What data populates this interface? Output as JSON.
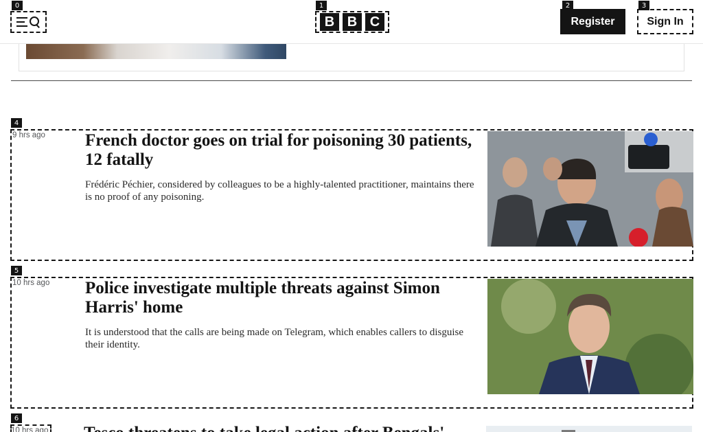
{
  "header": {
    "menu_label": "Menu and search",
    "logo_letters": [
      "B",
      "B",
      "C"
    ],
    "register_label": "Register",
    "signin_label": "Sign In",
    "badges": [
      "0",
      "1",
      "2",
      "3"
    ]
  },
  "articles": [
    {
      "badge": "4",
      "timestamp": "9 hrs ago",
      "title": "French doctor goes on trial for poisoning 30 patients, 12 fatally",
      "summary": "Frédéric Péchier, considered by colleagues to be a highly-talented practitioner, maintains there is no proof of any poisoning."
    },
    {
      "badge": "5",
      "timestamp": "10 hrs ago",
      "title": "Police investigate multiple threats against Simon Harris' home",
      "summary": "It is understood that the calls are being made on Telegram, which enables callers to disguise their identity."
    },
    {
      "badge": "6",
      "timestamp": "10 hrs ago",
      "title": "Tesco threatens to take legal action after Bengals' ...",
      "summary": ""
    }
  ],
  "colors": {
    "ink": "#141414",
    "muted": "#545658",
    "white": "#ffffff"
  }
}
